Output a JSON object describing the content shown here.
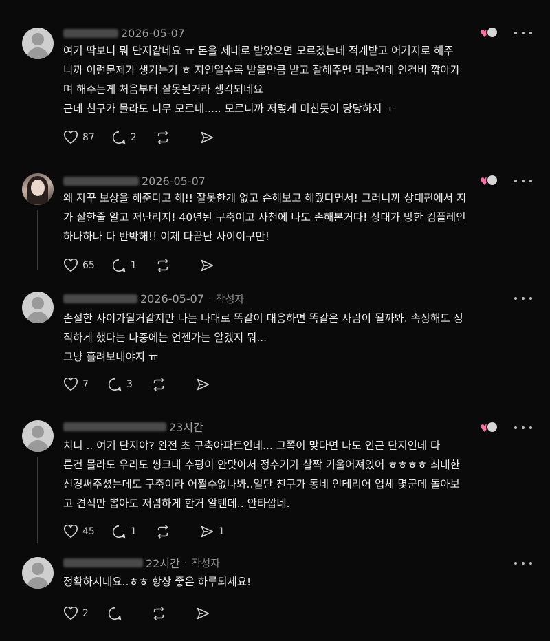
{
  "comments": [
    {
      "date": "2026-05-07",
      "author_tag": "",
      "lines": [
        "여기 딱보니 뭐 단지같네요 ㅠ 돈을 제대로 받았으면 모르겠는데 적게받고 어거지로 해주",
        "니까 이런문제가 생기는거 ㅎ 지인일수록 받을만큼 받고 잘해주면 되는건데 인건비 깎아가",
        "며 해주는게 처음부터 잘못된거라 생각되네요",
        "근데 친구가 몰라도 너무 모르네..... 모르니까 저렇게 미친듯이 당당하지 ㅜ"
      ],
      "likes": "87",
      "replies": "2",
      "shares": ""
    },
    {
      "date": "2026-05-07",
      "author_tag": "",
      "lines": [
        "왜 자꾸 보상을 해준다고 해!! 잘못한게 없고 손해보고 해줬다면서! 그러니까 상대편에서 지",
        "가 잘한줄 알고 저난리지! 40년된 구축이고 사천에 나도 손해본거다! 상대가 망한 컴플레인",
        "하나하나 다 반박해!! 이제 다끝난 사이이구만!"
      ],
      "likes": "65",
      "replies": "1",
      "shares": ""
    },
    {
      "date": "2026-05-07",
      "author_tag": "작성자",
      "lines": [
        "손절한 사이가될거같지만 나는 나대로 똑같이 대응하면 똑같은 사람이 될까봐. 속상해도 정",
        "직하게 했다는 나중에는 언젠가는 알겠지 뭐...",
        "그냥 흘려보내야지 ㅠ"
      ],
      "likes": "7",
      "replies": "3",
      "shares": ""
    },
    {
      "date": "23시간",
      "author_tag": "",
      "lines": [
        "치니 .. 여기 단지야? 완전 초 구축아파트인데... 그쪽이 맞다면 나도 인근 단지인데 다",
        "른건 몰라도 우리도 씽크대 수평이 안맞아서 정수기가 살짝 기울어져있어 ㅎㅎㅎㅎ 최대한",
        "신경써주셨는데도 구축이라 어쩔수없나봐..일단 친구가 동네 인테리어 업체 몇군데 돌아보",
        "고 견적만 뽑아도 저렴하게 한거 알텐데.. 안타깝네."
      ],
      "likes": "45",
      "replies": "1",
      "shares": "1"
    },
    {
      "date": "22시간",
      "author_tag": "작성자",
      "lines": [
        "정확하시네요..ㅎㅎ 항상 좋은 하루되세요!"
      ],
      "likes": "2",
      "replies": "",
      "shares": ""
    }
  ],
  "colors": {
    "background": "#0a0a0a",
    "text": "#ececec",
    "meta": "#8c8c8c",
    "heart_badge": "#ff6fa8"
  },
  "icons": {
    "like": "heart-outline-icon",
    "reply": "speech-bubble-icon",
    "repost": "repost-arrows-icon",
    "share": "paper-plane-icon",
    "more": "more-dots-icon"
  }
}
